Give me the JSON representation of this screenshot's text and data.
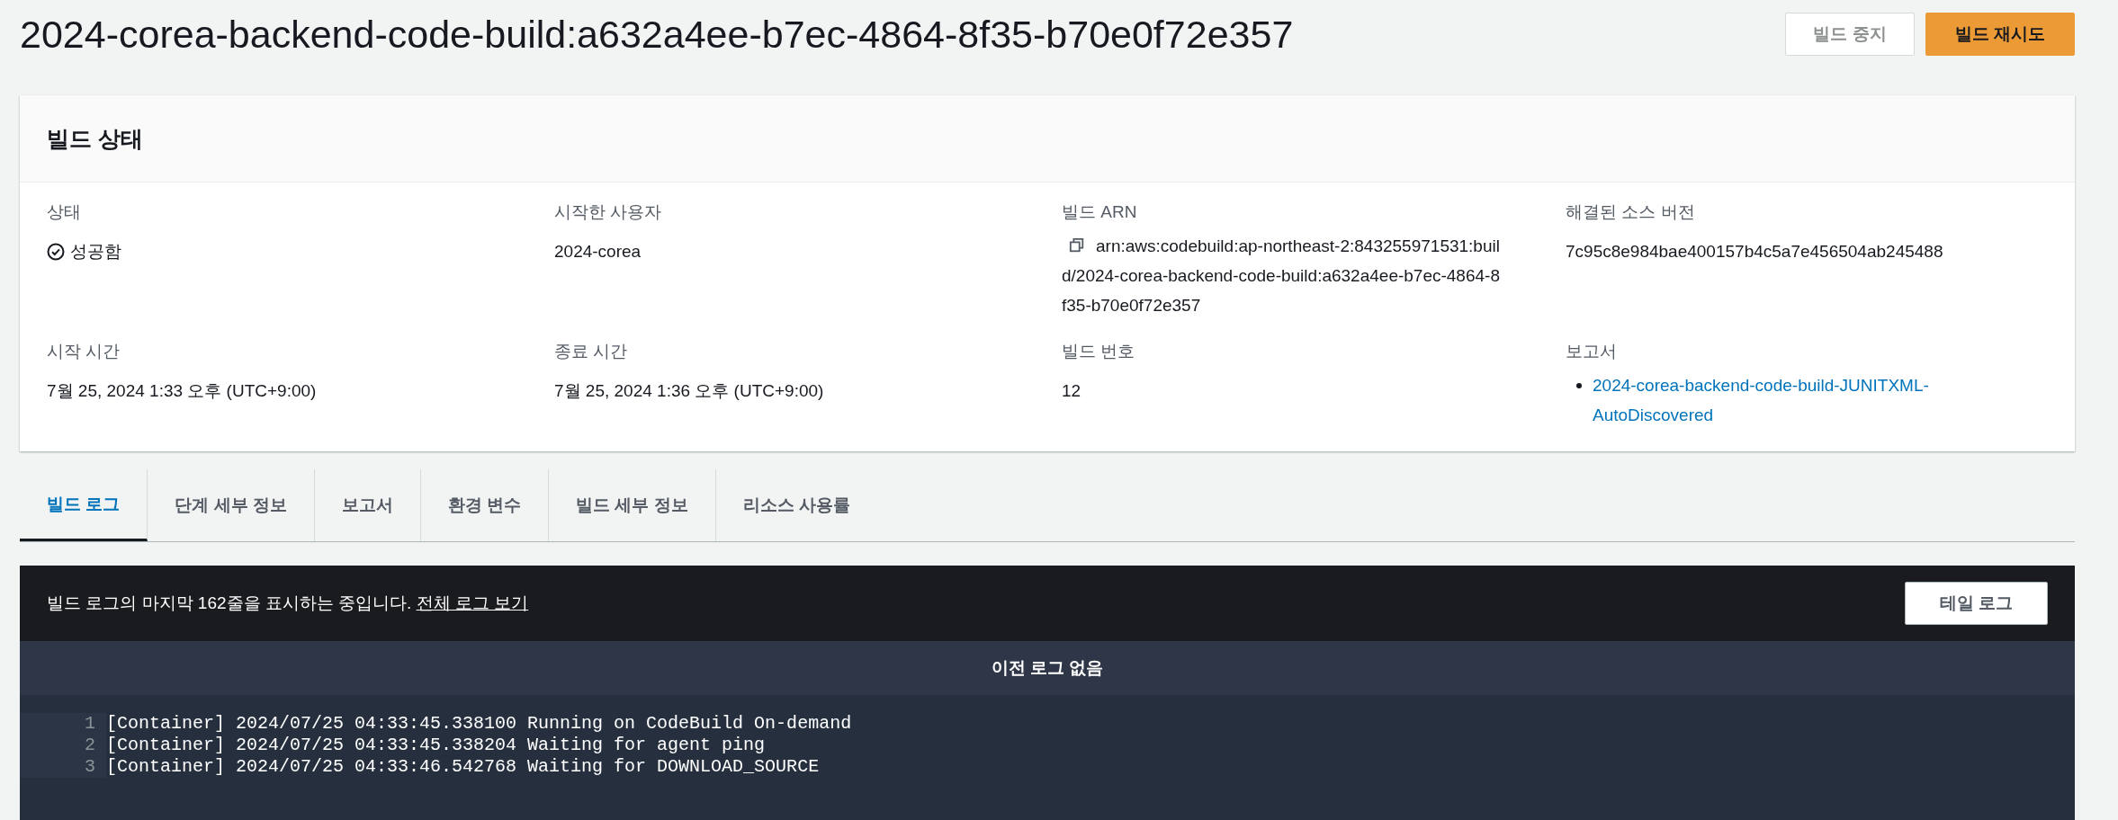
{
  "page": {
    "title": "2024-corea-backend-code-build:a632a4ee-b7ec-4864-8f35-b70e0f72e357"
  },
  "actions": [
    {
      "label": "빌드 중지",
      "kind": "normal",
      "disabled": true
    },
    {
      "label": "빌드 재시도",
      "kind": "primary",
      "disabled": false
    }
  ],
  "build_status": {
    "title": "빌드 상태",
    "fields": [
      {
        "kind": "status",
        "label": "상태",
        "value": "성공함"
      },
      {
        "kind": "text",
        "label": "시작한 사용자",
        "value": "2024-corea"
      },
      {
        "kind": "copy",
        "label": "빌드 ARN",
        "value": "arn:aws:codebuild:ap-northeast-2:843255971531:build/2024-corea-backend-code-build:a632a4ee-b7ec-4864-8f35-b70e0f72e357"
      },
      {
        "kind": "text",
        "label": "해결된 소스 버전",
        "value": "7c95c8e984bae400157b4c5a7e456504ab245488"
      },
      {
        "kind": "text",
        "label": "시작 시간",
        "value": "7월 25, 2024 1:33 오후 (UTC+9:00)"
      },
      {
        "kind": "text",
        "label": "종료 시간",
        "value": "7월 25, 2024 1:36 오후 (UTC+9:00)"
      },
      {
        "kind": "text",
        "label": "빌드 번호",
        "value": "12"
      },
      {
        "kind": "links",
        "label": "보고서",
        "links": [
          "2024-corea-backend-code-build-JUNITXML-AutoDiscovered"
        ]
      }
    ]
  },
  "tabs": [
    {
      "label": "빌드 로그",
      "selected": true
    },
    {
      "label": "단계 세부 정보",
      "selected": false
    },
    {
      "label": "보고서",
      "selected": false
    },
    {
      "label": "환경 변수",
      "selected": false
    },
    {
      "label": "빌드 세부 정보",
      "selected": false
    },
    {
      "label": "리소스 사용률",
      "selected": false
    }
  ],
  "log": {
    "notice": "빌드 로그의 마지막 162줄을 표시하는 중입니다.",
    "full_log_link": "전체 로그 보기",
    "tail_button": "테일 로그",
    "previous": "이전 로그 없음",
    "lines": [
      {
        "number": "1",
        "text": "[Container] 2024/07/25 04:33:45.338100 Running on CodeBuild On-demand"
      },
      {
        "number": "2",
        "text": "[Container] 2024/07/25 04:33:45.338204 Waiting for agent ping"
      },
      {
        "number": "3",
        "text": "[Container] 2024/07/25 04:33:46.542768 Waiting for DOWNLOAD_SOURCE"
      }
    ]
  }
}
